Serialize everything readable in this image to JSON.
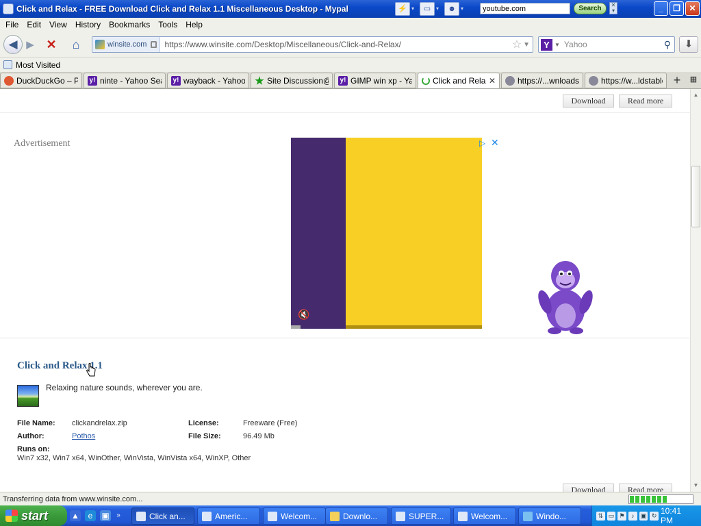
{
  "window": {
    "title": "Click and Relax - FREE Download Click and Relax 1.1 Miscellaneous Desktop - Mypal",
    "toolbar_search_value": "youtube.com",
    "toolbar_search_button": "Search",
    "minimize": "_",
    "maximize": "❐",
    "close": "✕"
  },
  "menu": {
    "items": [
      "File",
      "Edit",
      "View",
      "History",
      "Bookmarks",
      "Tools",
      "Help"
    ]
  },
  "nav": {
    "identity_label": "winsite.com",
    "url": "https://www.winsite.com/Desktop/Miscellaneous/Click-and-Relax/",
    "search_placeholder": "Yahoo",
    "search_engine_icon": "Y"
  },
  "bookmarks": {
    "most_visited": "Most Visited"
  },
  "tabs": [
    {
      "label": "DuckDuckGo – P...",
      "icon": "duckduckgo-icon"
    },
    {
      "label": "ninte - Yahoo Sea...",
      "icon": "yahoo-icon"
    },
    {
      "label": "wayback - Yahoo ...",
      "icon": "yahoo-icon"
    },
    {
      "label": "Site Discussion@...",
      "icon": "star-icon"
    },
    {
      "label": "GIMP win xp - Ya...",
      "icon": "yahoo-icon"
    },
    {
      "label": "Click and Rela...",
      "icon": "loading-spinner-icon",
      "active": true
    },
    {
      "label": "https://...wnloads/",
      "icon": "globe-icon"
    },
    {
      "label": "https://w...ldstable/",
      "icon": "globe-icon"
    }
  ],
  "page": {
    "download_label": "Download",
    "read_more_label": "Read more",
    "advertisement_label": "Advertisement",
    "program_title": "Click and Relax",
    "program_version": "1.1",
    "program_description": "Relaxing nature sounds, wherever you are.",
    "file_name_label": "File Name:",
    "file_name": "clickandrelax.zip",
    "license_label": "License:",
    "license": "Freeware (Free)",
    "author_label": "Author:",
    "author": "Pothos",
    "file_size_label": "File Size:",
    "file_size": "96.49 Mb",
    "runs_on_label": "Runs on:",
    "runs_on": "Win7 x32, Win7 x64, WinOther, WinVista, WinVista x64, WinXP, Other"
  },
  "status": {
    "text": "Transferring data from www.winsite.com..."
  },
  "taskbar": {
    "start_label": "start",
    "tasks": [
      {
        "label": "Click an...",
        "active": true
      },
      {
        "label": "Americ..."
      },
      {
        "label": "Welcom..."
      },
      {
        "label": "Downlo..."
      },
      {
        "label": "SUPER..."
      },
      {
        "label": "Welcom..."
      },
      {
        "label": "Windo..."
      }
    ],
    "clock": "10:41 PM"
  },
  "colors": {
    "ad_purple": "#452a6e",
    "ad_yellow": "#f8cf25",
    "link_blue": "#2a5a8a",
    "xp_blue": "#245edb",
    "start_green": "#3a9a3a"
  }
}
